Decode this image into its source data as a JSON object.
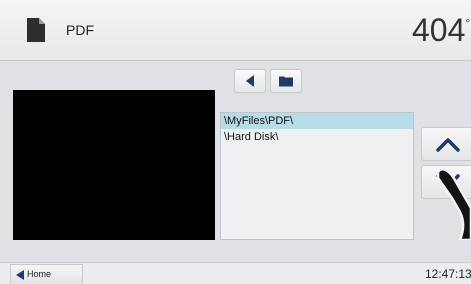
{
  "header": {
    "title": "PDF",
    "temperature": "404",
    "temperature_unit": "°",
    "doc_icon": "document-icon"
  },
  "navigation": {
    "back_icon": "arrow-left-icon",
    "folder_icon": "folder-icon"
  },
  "folders": [
    {
      "label": "\\MyFiles\\PDF\\",
      "selected": true
    },
    {
      "label": "\\Hard Disk\\",
      "selected": false
    }
  ],
  "scroll": {
    "up_icon": "chevron-up-icon",
    "down_icon": "chevron-down-icon"
  },
  "footer": {
    "home_label": "Home",
    "time": "12:47:13"
  },
  "colors": {
    "background": "#dfe1e4",
    "selected_row": "#b6dce8",
    "accent": "#1f3a66"
  }
}
